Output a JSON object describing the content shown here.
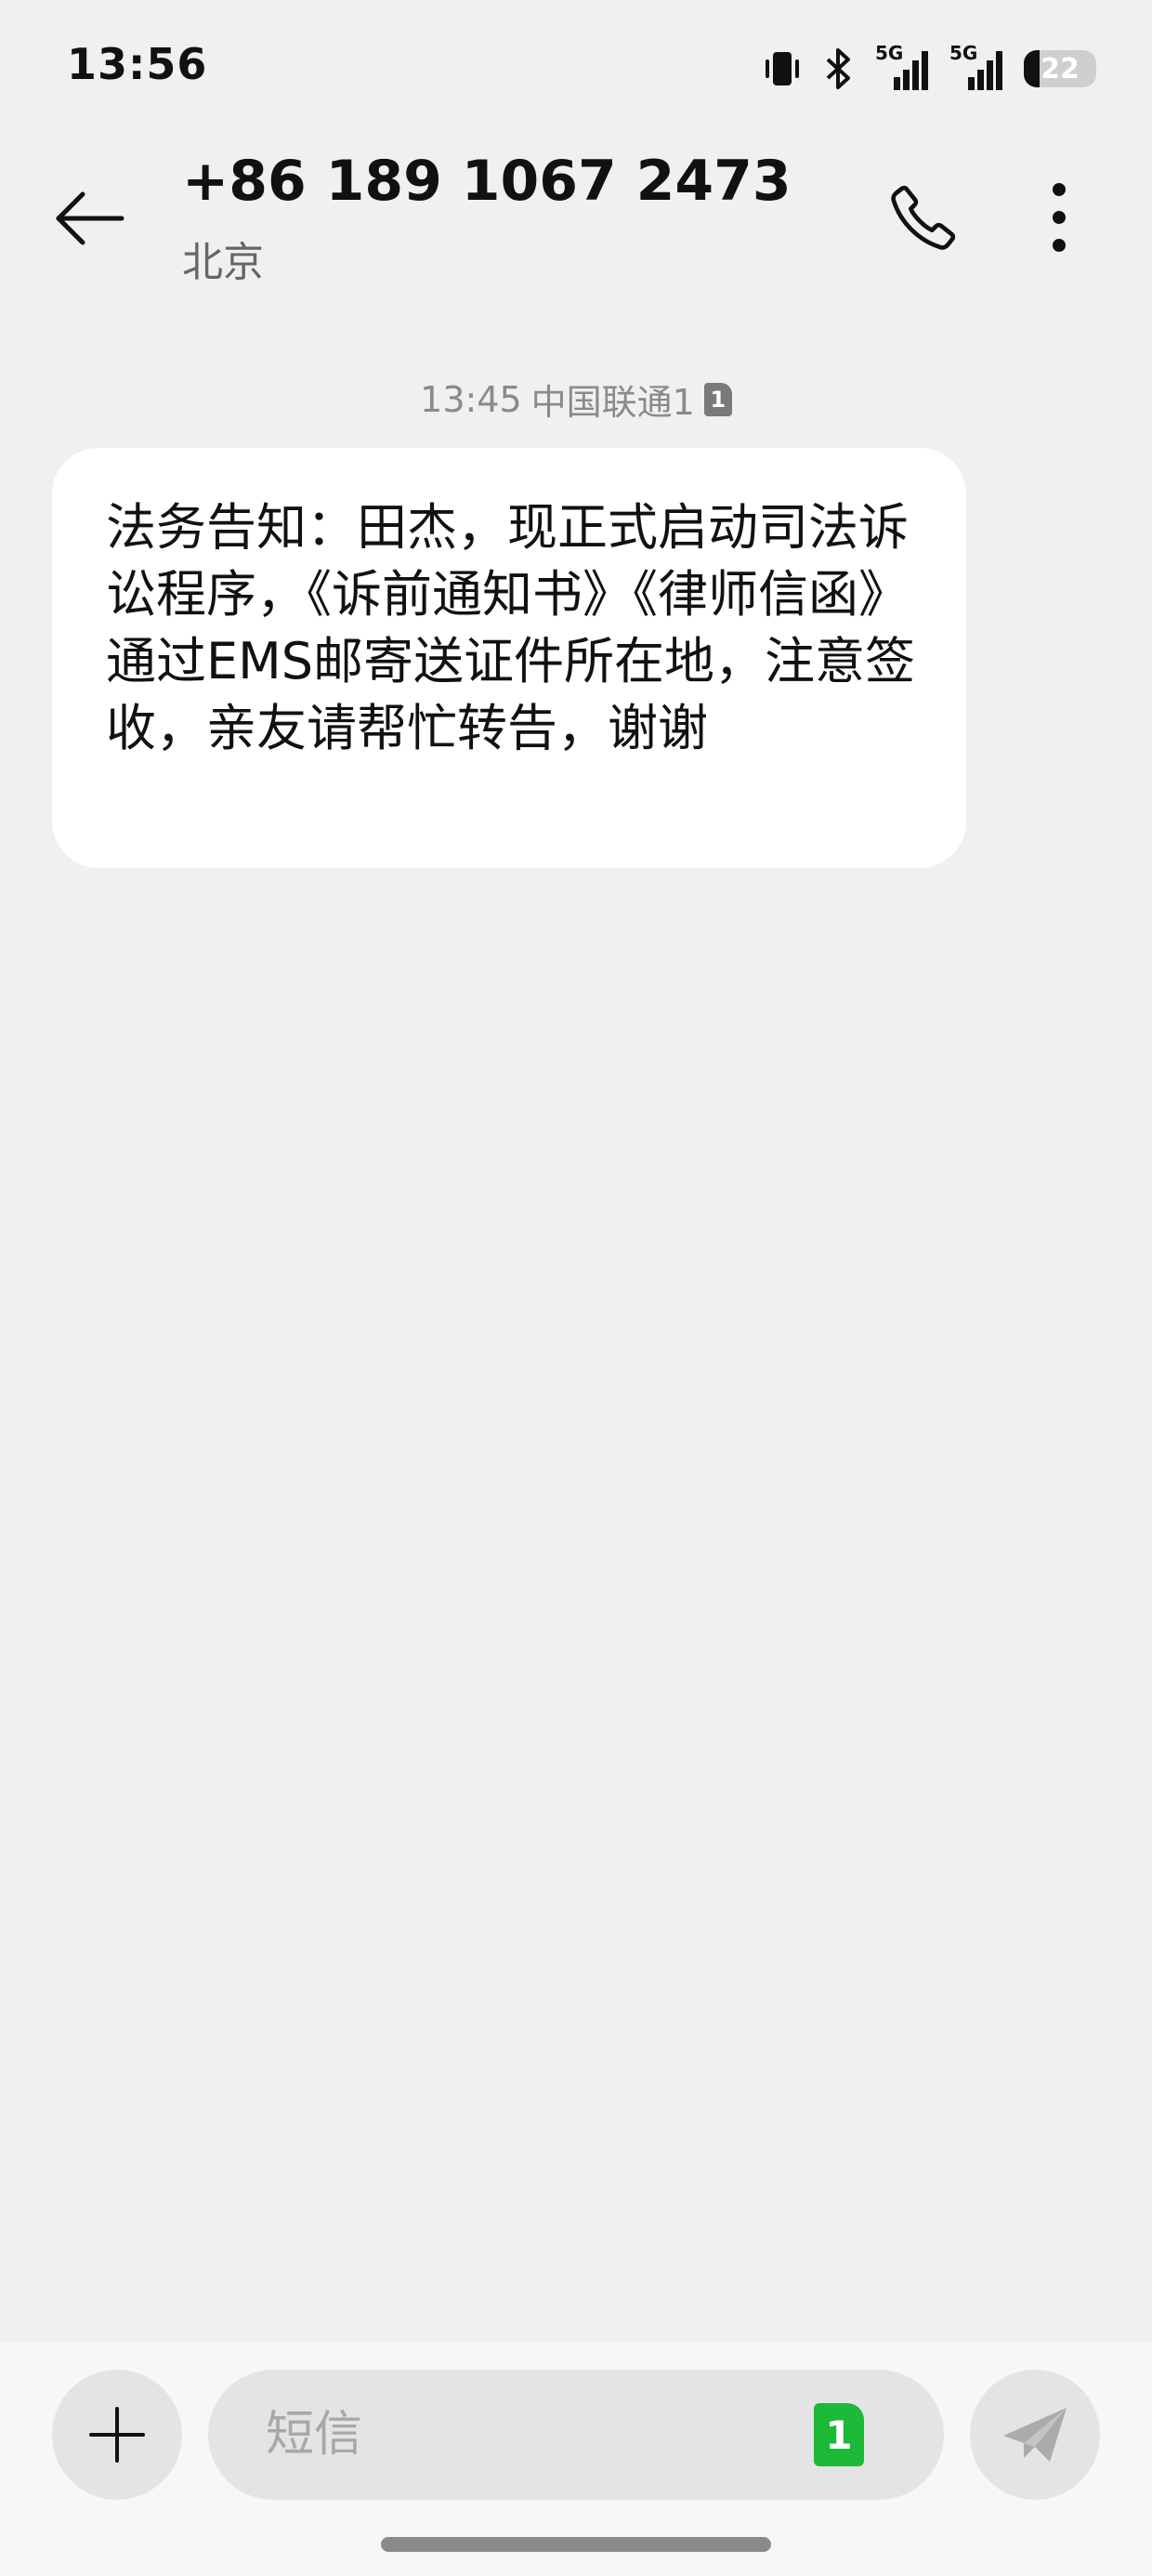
{
  "status_bar": {
    "time": "13:56",
    "icons": [
      "vibrate-icon",
      "bluetooth-icon",
      "signal-5g-icon",
      "signal-5g-icon",
      "battery-icon"
    ],
    "network_label": "5G",
    "battery": 22
  },
  "header": {
    "back_icon": "arrow-left-icon",
    "contact_number": "+86 189 1067 2473",
    "contact_location": "北京",
    "call_icon": "phone-icon",
    "more_icon": "more-vertical-icon"
  },
  "conversation": {
    "messages": [
      {
        "time": "13:45",
        "carrier": "中国联通1",
        "sim": "1",
        "body": "法务告知：田杰，现正式启动司法诉讼程序，《诉前通知书》《律师信函》通过EMS邮寄送证件所在地，注意签收，亲友请帮忙转告，谢谢"
      }
    ]
  },
  "composer": {
    "add_icon": "plus-icon",
    "placeholder": "短信",
    "sim": "1",
    "sim_color": "#1db938",
    "send_icon": "send-icon"
  },
  "colors": {
    "background": "#eff0f2",
    "bubble": "#ffffff",
    "sim_green": "#1db938"
  }
}
